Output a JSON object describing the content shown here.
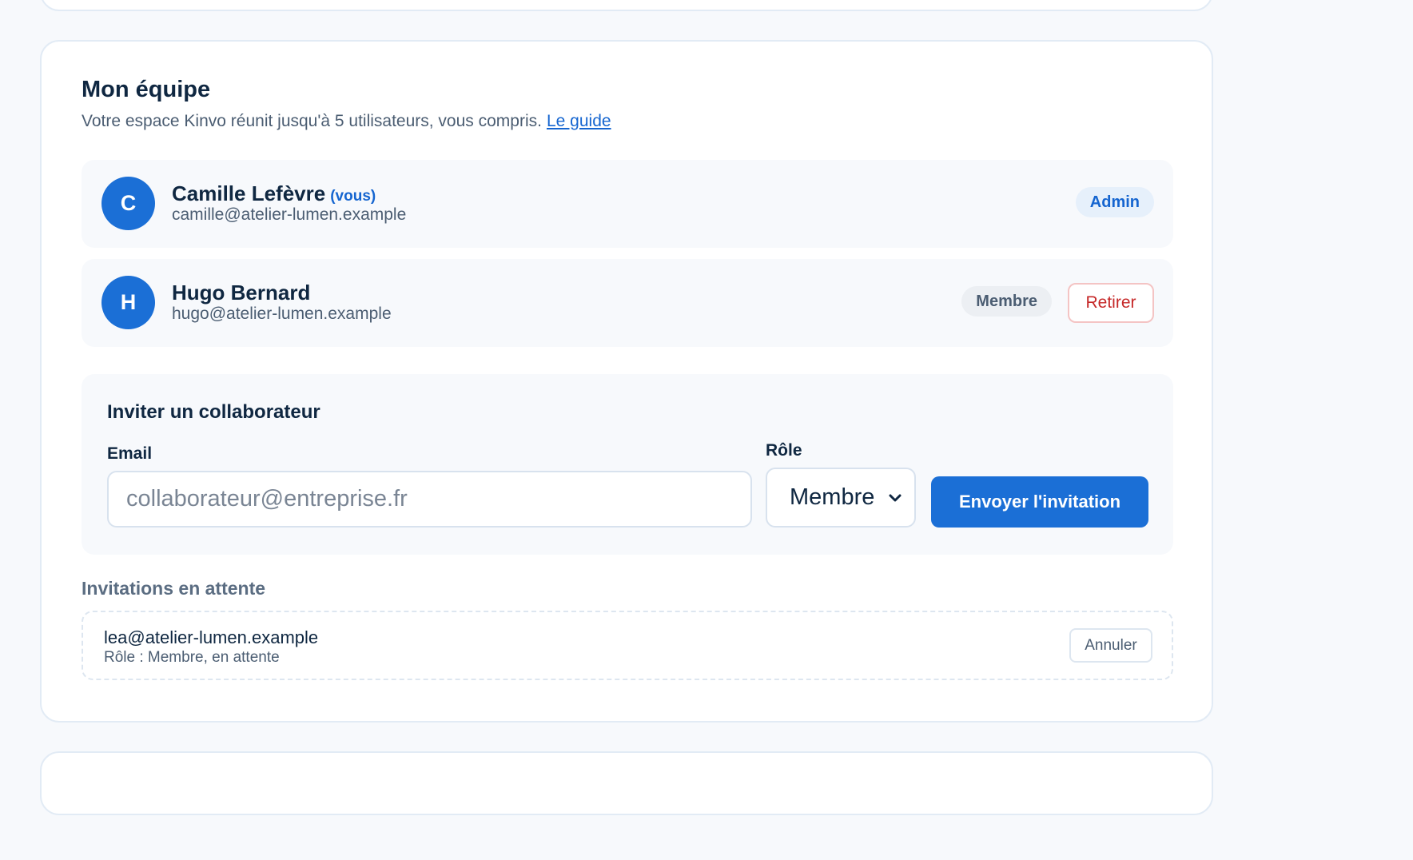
{
  "team": {
    "title": "Mon équipe",
    "subtitle": "Votre espace Kinvo réunit jusqu'à 5 utilisateurs, vous compris.",
    "guide_link": "Le guide"
  },
  "members": [
    {
      "initial": "C",
      "name": "Camille Lefèvre",
      "you_label": "(vous)",
      "email": "camille@atelier-lumen.example",
      "role_badge": "Admin"
    },
    {
      "initial": "H",
      "name": "Hugo Bernard",
      "email": "hugo@atelier-lumen.example",
      "role_badge": "Membre",
      "remove_label": "Retirer"
    }
  ],
  "invite": {
    "title": "Inviter un collaborateur",
    "email_label": "Email",
    "email_placeholder": "collaborateur@entreprise.fr",
    "email_value": "",
    "role_label": "Rôle",
    "role_value": "Membre",
    "send_label": "Envoyer l'invitation"
  },
  "pending": {
    "title": "Invitations en attente",
    "items": [
      {
        "email": "lea@atelier-lumen.example",
        "role_text": "Rôle : Membre, en attente",
        "cancel_label": "Annuler"
      }
    ]
  },
  "colors": {
    "primary": "#1b6fd6",
    "danger": "#c62828",
    "text": "#0f2741",
    "muted": "#4b5d72"
  },
  "icons": {
    "select_chevron": "chevron-down-icon"
  }
}
